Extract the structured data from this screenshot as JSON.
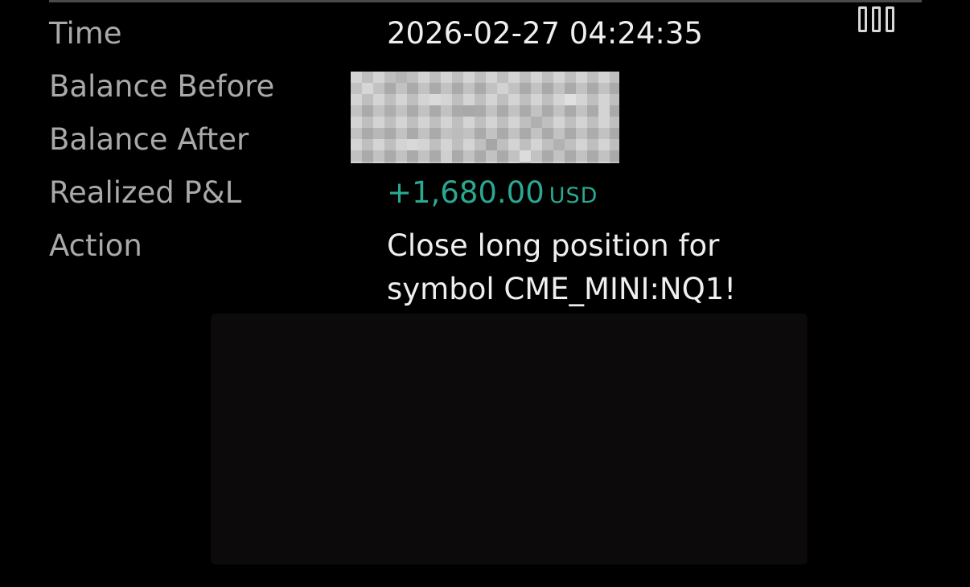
{
  "details": {
    "time": {
      "label": "Time",
      "value": "2026-02-27 04:24:35"
    },
    "balance_before": {
      "label": "Balance Before"
    },
    "balance_after": {
      "label": "Balance After"
    },
    "realized_pnl": {
      "label": "Realized P&L",
      "value": "+1,680.00",
      "unit": "USD",
      "color": "#2aa892"
    },
    "action": {
      "label": "Action",
      "value_line1": "Close long position for",
      "value_line2": "symbol CME_MINI:NQ1!"
    }
  },
  "icons": {
    "top_right": "columns-icon"
  }
}
